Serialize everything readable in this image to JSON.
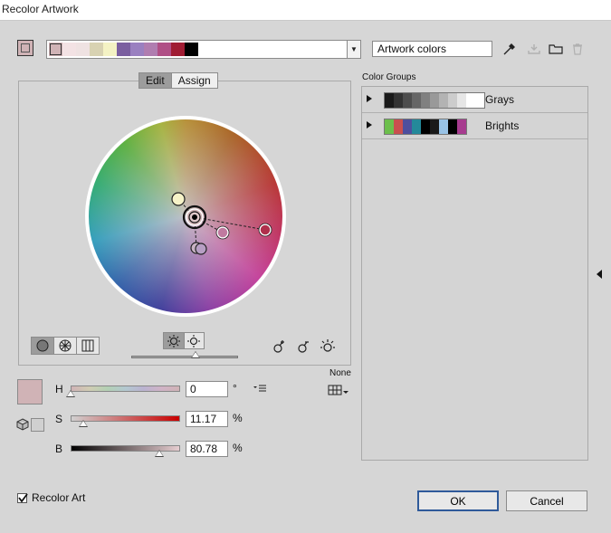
{
  "window": {
    "title": "Recolor Artwork"
  },
  "header": {
    "color_strip": [
      "#d0b3b6",
      "#f3e2e4",
      "#efe2e2",
      "#d8d2b2",
      "#f4f2c4",
      "#7b5fa0",
      "#9a80c0",
      "#b07db0",
      "#b04f86",
      "#a01c33",
      "#000000"
    ],
    "preset_name": "Artwork colors"
  },
  "edit_panel": {
    "tabs": [
      {
        "label": "Edit",
        "active": true
      },
      {
        "label": "Assign",
        "active": false
      }
    ]
  },
  "sliders": {
    "mode_label": "None",
    "h": {
      "label": "H",
      "value": "0",
      "unit": "°",
      "level": 0.0
    },
    "s": {
      "label": "S",
      "value": "11.17",
      "unit": "%",
      "level": 0.1117
    },
    "b": {
      "label": "B",
      "value": "80.78",
      "unit": "%",
      "level": 0.8078
    },
    "current_color": "#d0b3b6",
    "brightness_level": 0.6
  },
  "color_groups": {
    "label": "Color Groups",
    "groups": [
      {
        "name": "Grays",
        "swatches": [
          "#1a1a1a",
          "#333333",
          "#4d4d4d",
          "#666666",
          "#808080",
          "#999999",
          "#b3b3b3",
          "#cccccc",
          "#e6e6e6",
          "#ffffff",
          "#ffffff"
        ]
      },
      {
        "name": "Brights",
        "swatches": [
          "#6cbf4c",
          "#c9504f",
          "#4d4f9e",
          "#24899a",
          "#000000",
          "#1a1a1a",
          "#99c3e6",
          "#000000",
          "#a73b8f"
        ]
      }
    ]
  },
  "footer": {
    "recolor_art_label": "Recolor Art",
    "recolor_art_checked": true,
    "ok_label": "OK",
    "cancel_label": "Cancel"
  }
}
